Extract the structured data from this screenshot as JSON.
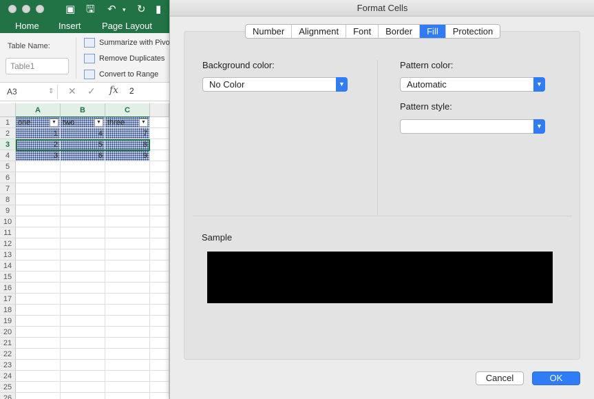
{
  "excel": {
    "ribbon_tabs": [
      "Home",
      "Insert",
      "Page Layout"
    ],
    "table_name_label": "Table Name:",
    "table_name_value": "Table1",
    "commands": [
      "Summarize with Pivo",
      "Remove Duplicates",
      "Convert to Range"
    ],
    "name_box": "A3",
    "formula_icons": [
      "close-icon",
      "check-icon"
    ],
    "fx_label": "fx",
    "formula_value": "2",
    "columns": [
      "A",
      "B",
      "C"
    ],
    "rows": [
      "1",
      "2",
      "3",
      "4",
      "5",
      "6",
      "7",
      "8",
      "9",
      "10",
      "11",
      "12",
      "13",
      "14",
      "15",
      "16",
      "17",
      "18",
      "19",
      "20",
      "21",
      "22",
      "23",
      "24",
      "25",
      "26"
    ],
    "table": {
      "headers": [
        "one",
        "two",
        "three"
      ],
      "data": [
        [
          "1",
          "4",
          "7"
        ],
        [
          "2",
          "5",
          "8"
        ],
        [
          "3",
          "6",
          "9"
        ]
      ]
    },
    "accent": "#217346"
  },
  "dialog": {
    "title": "Format Cells",
    "tabs": [
      "Number",
      "Alignment",
      "Font",
      "Border",
      "Fill",
      "Protection"
    ],
    "active_tab": "Fill",
    "background_color_label": "Background color:",
    "background_color_value": "No Color",
    "pattern_color_label": "Pattern color:",
    "pattern_color_value": "Automatic",
    "pattern_style_label": "Pattern style:",
    "pattern_style_value": "",
    "sample_label": "Sample",
    "sample_color": "#000000",
    "cancel_label": "Cancel",
    "ok_label": "OK",
    "accent": "#2f7cf6"
  }
}
